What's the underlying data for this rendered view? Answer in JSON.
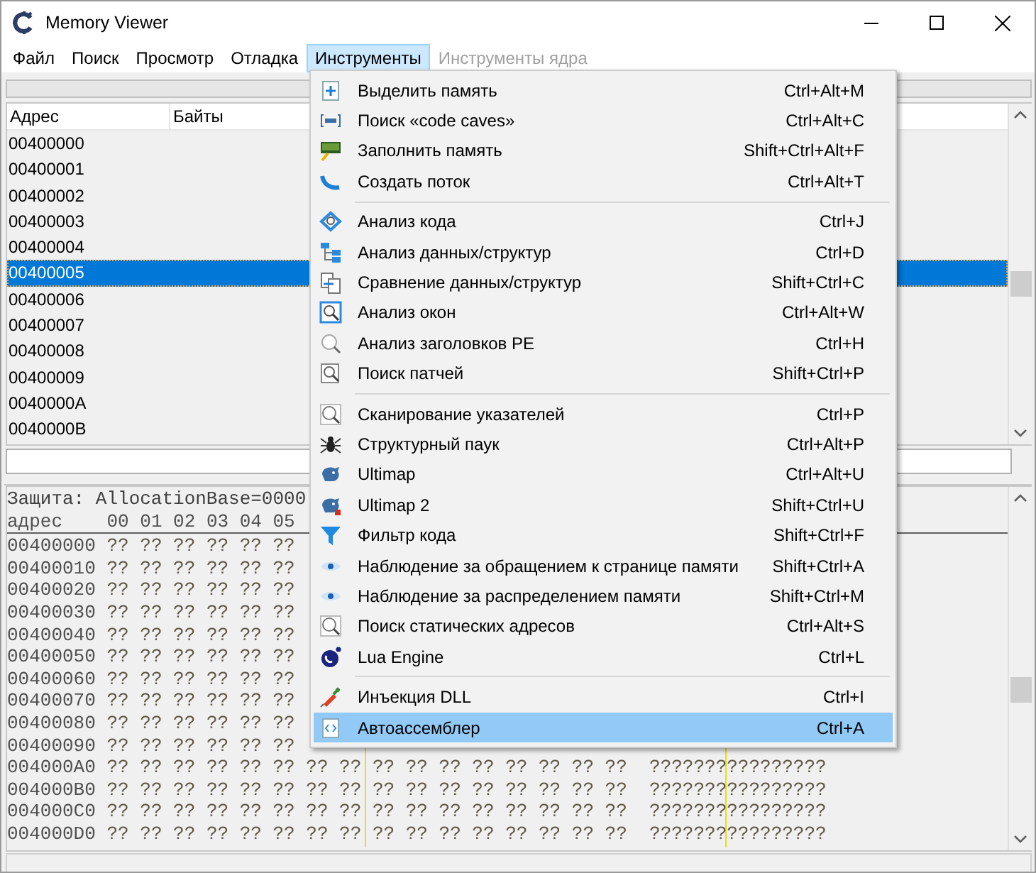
{
  "window": {
    "title": "Memory Viewer"
  },
  "menubar": [
    {
      "label": "Файл",
      "selected": false,
      "disabled": false
    },
    {
      "label": "Поиск",
      "selected": false,
      "disabled": false
    },
    {
      "label": "Просмотр",
      "selected": false,
      "disabled": false
    },
    {
      "label": "Отладка",
      "selected": false,
      "disabled": false
    },
    {
      "label": "Инструменты",
      "selected": true,
      "disabled": false
    },
    {
      "label": "Инструменты ядра",
      "selected": false,
      "disabled": true
    }
  ],
  "disassembly": {
    "columns": [
      "Адрес",
      "Байты"
    ],
    "rows": [
      {
        "address": "00400000",
        "selected": false
      },
      {
        "address": "00400001",
        "selected": false
      },
      {
        "address": "00400002",
        "selected": false
      },
      {
        "address": "00400003",
        "selected": false
      },
      {
        "address": "00400004",
        "selected": false
      },
      {
        "address": "00400005",
        "selected": true
      },
      {
        "address": "00400006",
        "selected": false
      },
      {
        "address": "00400007",
        "selected": false
      },
      {
        "address": "00400008",
        "selected": false
      },
      {
        "address": "00400009",
        "selected": false
      },
      {
        "address": "0040000A",
        "selected": false
      },
      {
        "address": "0040000B",
        "selected": false
      }
    ]
  },
  "hex_view": {
    "info": "Защита: AllocationBase=0000",
    "header_label": "адрес",
    "header_columns": "00 01 02 03 04 05",
    "rows": [
      {
        "address": "00400000",
        "bytes": "?? ?? ?? ?? ?? ??"
      },
      {
        "address": "00400010",
        "bytes": "?? ?? ?? ?? ?? ??"
      },
      {
        "address": "00400020",
        "bytes": "?? ?? ?? ?? ?? ??"
      },
      {
        "address": "00400030",
        "bytes": "?? ?? ?? ?? ?? ??"
      },
      {
        "address": "00400040",
        "bytes": "?? ?? ?? ?? ?? ??"
      },
      {
        "address": "00400050",
        "bytes": "?? ?? ?? ?? ?? ??"
      },
      {
        "address": "00400060",
        "bytes": "?? ?? ?? ?? ?? ??"
      },
      {
        "address": "00400070",
        "bytes": "?? ?? ?? ?? ?? ??"
      },
      {
        "address": "00400080",
        "bytes": "?? ?? ?? ?? ?? ??"
      },
      {
        "address": "00400090",
        "bytes": "?? ?? ?? ?? ?? ??"
      },
      {
        "address": "004000A0",
        "bytes": "?? ?? ?? ?? ?? ?? ?? ?? ?? ?? ?? ?? ?? ?? ?? ??",
        "ascii": "????????????????"
      },
      {
        "address": "004000B0",
        "bytes": "?? ?? ?? ?? ?? ?? ?? ?? ?? ?? ?? ?? ?? ?? ?? ??",
        "ascii": "????????????????"
      },
      {
        "address": "004000C0",
        "bytes": "?? ?? ?? ?? ?? ?? ?? ?? ?? ?? ?? ?? ?? ?? ?? ??",
        "ascii": "????????????????"
      },
      {
        "address": "004000D0",
        "bytes": "?? ?? ?? ?? ?? ?? ?? ?? ?? ?? ?? ?? ?? ?? ?? ??",
        "ascii": "????????????????"
      }
    ]
  },
  "tools_menu": {
    "groups": [
      [
        {
          "label": "Выделить память",
          "shortcut": "Ctrl+Alt+M",
          "selected": false
        },
        {
          "label": "Поиск «code caves»",
          "shortcut": "Ctrl+Alt+C",
          "selected": false
        },
        {
          "label": "Заполнить память",
          "shortcut": "Shift+Ctrl+Alt+F",
          "selected": false
        },
        {
          "label": "Создать поток",
          "shortcut": "Ctrl+Alt+T",
          "selected": false
        }
      ],
      [
        {
          "label": "Анализ кода",
          "shortcut": "Ctrl+J",
          "selected": false
        },
        {
          "label": "Анализ данных/структур",
          "shortcut": "Ctrl+D",
          "selected": false
        },
        {
          "label": "Сравнение данных/структур",
          "shortcut": "Shift+Ctrl+C",
          "selected": false
        },
        {
          "label": "Анализ окон",
          "shortcut": "Ctrl+Alt+W",
          "selected": false
        },
        {
          "label": "Анализ заголовков PE",
          "shortcut": "Ctrl+H",
          "selected": false
        },
        {
          "label": "Поиск патчей",
          "shortcut": "Shift+Ctrl+P",
          "selected": false
        }
      ],
      [
        {
          "label": "Сканирование указателей",
          "shortcut": "Ctrl+P",
          "selected": false
        },
        {
          "label": "Структурный паук",
          "shortcut": "Ctrl+Alt+P",
          "selected": false
        },
        {
          "label": "Ultimap",
          "shortcut": "Ctrl+Alt+U",
          "selected": false
        },
        {
          "label": "Ultimap 2",
          "shortcut": "Shift+Ctrl+U",
          "selected": false
        },
        {
          "label": "Фильтр кода",
          "shortcut": "Shift+Ctrl+F",
          "selected": false
        },
        {
          "label": "Наблюдение за обращением к странице памяти",
          "shortcut": "Shift+Ctrl+A",
          "selected": false
        },
        {
          "label": "Наблюдение за распределением памяти",
          "shortcut": "Shift+Ctrl+M",
          "selected": false
        },
        {
          "label": "Поиск статических адресов",
          "shortcut": "Ctrl+Alt+S",
          "selected": false
        },
        {
          "label": "Lua Engine",
          "shortcut": "Ctrl+L",
          "selected": false
        }
      ],
      [
        {
          "label": "Инъекция DLL",
          "shortcut": "Ctrl+I",
          "selected": false
        },
        {
          "label": "Автоассемблер",
          "shortcut": "Ctrl+A",
          "selected": true
        }
      ]
    ]
  }
}
